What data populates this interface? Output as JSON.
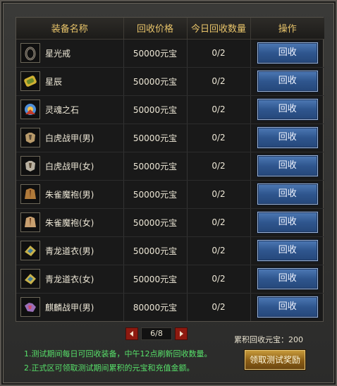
{
  "headers": {
    "name": "装备名称",
    "price": "回收价格",
    "count": "今日回收数量",
    "op": "操作"
  },
  "button_label": "回收",
  "rows": [
    {
      "name": "星光戒",
      "price": "50000元宝",
      "count": "0/2",
      "icon": "ring-icon",
      "color": "#9a8f7d"
    },
    {
      "name": "星辰",
      "price": "50000元宝",
      "count": "0/2",
      "icon": "gold-bracer-icon",
      "color": "#d1b032"
    },
    {
      "name": "灵魂之石",
      "price": "50000元宝",
      "count": "0/2",
      "icon": "soul-stone-icon",
      "color": "#4f8fd8"
    },
    {
      "name": "白虎战甲(男)",
      "price": "50000元宝",
      "count": "0/2",
      "icon": "armor-icon",
      "color": "#b89a6a"
    },
    {
      "name": "白虎战甲(女)",
      "price": "50000元宝",
      "count": "0/2",
      "icon": "armor-icon",
      "color": "#b8b0a0"
    },
    {
      "name": "朱雀魔袍(男)",
      "price": "50000元宝",
      "count": "0/2",
      "icon": "robe-icon",
      "color": "#b07a3a"
    },
    {
      "name": "朱雀魔袍(女)",
      "price": "50000元宝",
      "count": "0/2",
      "icon": "robe-icon",
      "color": "#c8a070"
    },
    {
      "name": "青龙道衣(男)",
      "price": "50000元宝",
      "count": "0/2",
      "icon": "taoist-robe-icon",
      "color": "#c9b24a"
    },
    {
      "name": "青龙道衣(女)",
      "price": "50000元宝",
      "count": "0/2",
      "icon": "taoist-robe-icon",
      "color": "#c9b24a"
    },
    {
      "name": "麒麟战甲(男)",
      "price": "80000元宝",
      "count": "0/2",
      "icon": "qilin-armor-icon",
      "color": "#9a6fb8"
    }
  ],
  "pager": {
    "indicator": "6/8"
  },
  "total_label": "累积回收元宝：200",
  "notes": [
    "1.测试期间每日可回收装备，中午12点刷新回收数量。",
    "2.正式区可领取测试期间累积的元宝和充值金额。"
  ],
  "claim_button": "领取测试奖励",
  "colors": {
    "header_text": "#e8c46a",
    "note_text": "#57e06a",
    "button_blue": "#2f568e",
    "claim_gold": "#8a5d16",
    "arrow_red": "#8e1a10"
  }
}
